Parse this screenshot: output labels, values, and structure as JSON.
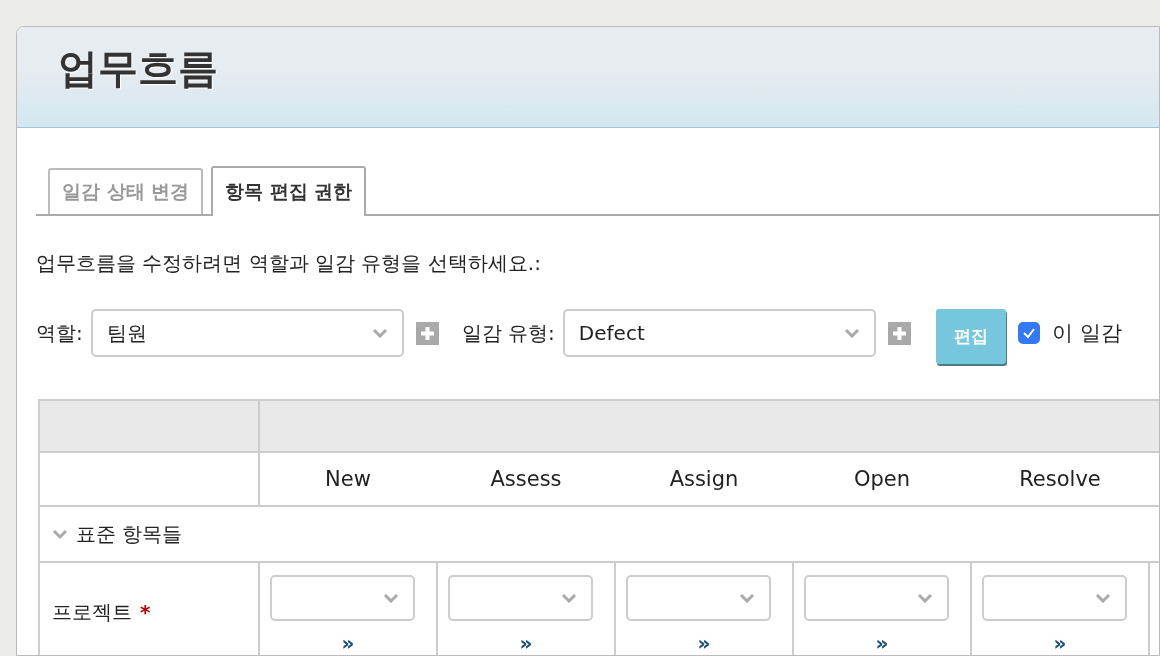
{
  "page": {
    "title": "업무흐름"
  },
  "tabs": [
    {
      "label": "일감 상태 변경",
      "selected": false
    },
    {
      "label": "항목 편집 권한",
      "selected": true
    }
  ],
  "instruction": "업무흐름을 수정하려면 역할과 일감 유형을 선택하세요.:",
  "filters": [
    {
      "label": "역할:",
      "value": "팀원"
    },
    {
      "label": "일감 유형:",
      "value": "Defect"
    }
  ],
  "edit_button": "편집",
  "checkbox": {
    "label": "이 일감",
    "checked": true
  },
  "table": {
    "columns": [
      "New",
      "Assess",
      "Assign",
      "Open",
      "Resolve"
    ],
    "sections": [
      {
        "label": "표준 항목들",
        "expanded": true,
        "rows": [
          {
            "label": "프로젝트",
            "required_mark": "*",
            "cells": [
              {
                "link": "»"
              },
              {
                "link": "»"
              },
              {
                "link": "»"
              },
              {
                "link": "»"
              },
              {
                "link": "»"
              }
            ]
          }
        ]
      }
    ]
  }
}
